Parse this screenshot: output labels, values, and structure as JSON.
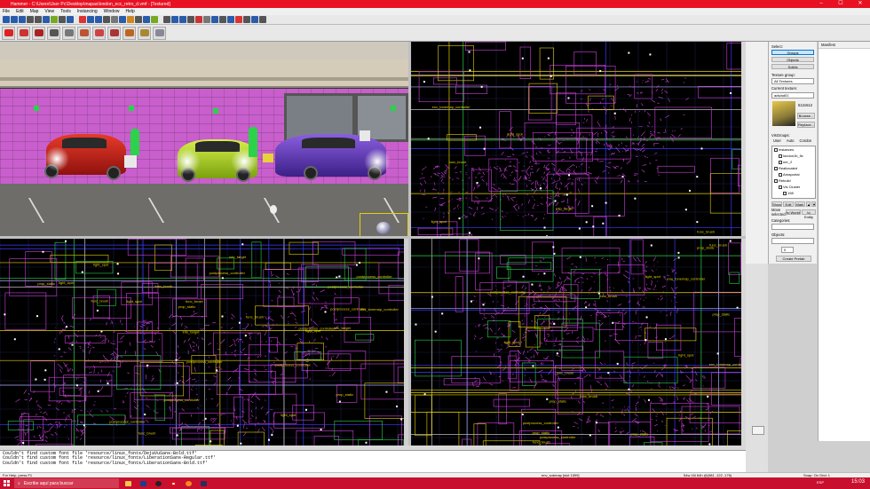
{
  "window": {
    "title": "Hammer - C:\\Users\\User Pc\\Desktop\\mapas\\london_ecc_retro_d.vmf - [Textured]",
    "controls": [
      "–",
      "☐",
      "✕"
    ]
  },
  "menu": [
    "File",
    "Edit",
    "Map",
    "View",
    "Tools",
    "Instancing",
    "Window",
    "Help"
  ],
  "toolbar_tools": [
    {
      "name": "selection-tool",
      "color": "#d22"
    },
    {
      "name": "magnify-tool",
      "color": "#c33"
    },
    {
      "name": "camera-tool",
      "color": "#a22"
    },
    {
      "name": "entity-tool",
      "color": "#555"
    },
    {
      "name": "block-tool",
      "color": "#777"
    },
    {
      "name": "texture-tool",
      "color": "#b53"
    },
    {
      "name": "apply-texture-tool",
      "color": "#c44"
    },
    {
      "name": "decal-tool",
      "color": "#a33"
    },
    {
      "name": "overlay-tool",
      "color": "#b62"
    },
    {
      "name": "clip-tool",
      "color": "#a83"
    },
    {
      "name": "vertex-tool",
      "color": "#889"
    }
  ],
  "viewport_3d": {
    "cars": [
      {
        "name": "red-car",
        "color": "#c0201a"
      },
      {
        "name": "green-car",
        "color": "#b6e02a"
      },
      {
        "name": "purple-car",
        "color": "#6a3fb8"
      }
    ]
  },
  "viewports_2d": {
    "wire_color": "#d040e0",
    "labels": [
      "prop_static",
      "postprocess_controller",
      "env_tonemap_controller",
      "info_target",
      "light_spot",
      "func_brush"
    ]
  },
  "right_panel": {
    "select_label": "Select:",
    "select_buttons": [
      "Groups",
      "Objects",
      "Solids"
    ],
    "selected_button": "Groups",
    "texture_group_label": "Texture group:",
    "texture_group_value": "All Textures",
    "current_texture_label": "Current texture:",
    "current_texture_value": "ads/ad01",
    "texture_size": "512x512",
    "browse_button": "Browse...",
    "replace_button": "Replace...",
    "visgroups_label": "VisGroups:",
    "visgroup_tabs": [
      "User",
      "Auto",
      "Cordon"
    ],
    "visgroup_items": [
      {
        "label": "Instances",
        "indent": 0
      },
      {
        "label": "london1b_fix",
        "indent": 1
      },
      {
        "label": "ner_2",
        "indent": 1
      },
      {
        "label": "Reallocated",
        "indent": 0
      },
      {
        "label": "Areaportal",
        "indent": 1
      },
      {
        "label": "Rebuild",
        "indent": 0
      },
      {
        "label": "Vis Cluster",
        "indent": 1
      },
      {
        "label": "198",
        "indent": 2
      }
    ],
    "visgroup_buttons": [
      "Show",
      "Edit",
      "Mark"
    ],
    "move_selected_label": "Move selected:",
    "move_buttons": [
      "to World",
      "to Entity"
    ],
    "categories_label": "Categories:",
    "objects_label": "Objects:",
    "objects_count": "0",
    "create_prefab_button": "Create Prefab"
  },
  "manifest": {
    "title": "Manifest"
  },
  "console": [
    "Couldn't find custom font file 'resource/linux_fonts/DejaVuSans-Bold.ttf'",
    "Couldn't find custom font file 'resource/linux_fonts/LiberationSans-Regular.ttf'",
    "Couldn't find custom font file 'resource/linux_fonts/LiberationSans-Bold.ttf'"
  ],
  "status": {
    "help": "For Help, press F1",
    "selection": "env_submap  [slot 1599]",
    "dimensions": "54w 16l 64h @(981 -122 -176)",
    "snap": "Snap: On Grid: 1"
  },
  "taskbar": {
    "search_placeholder": "Escribe aquí para buscar",
    "tray": "ESP",
    "time": "15:03"
  }
}
